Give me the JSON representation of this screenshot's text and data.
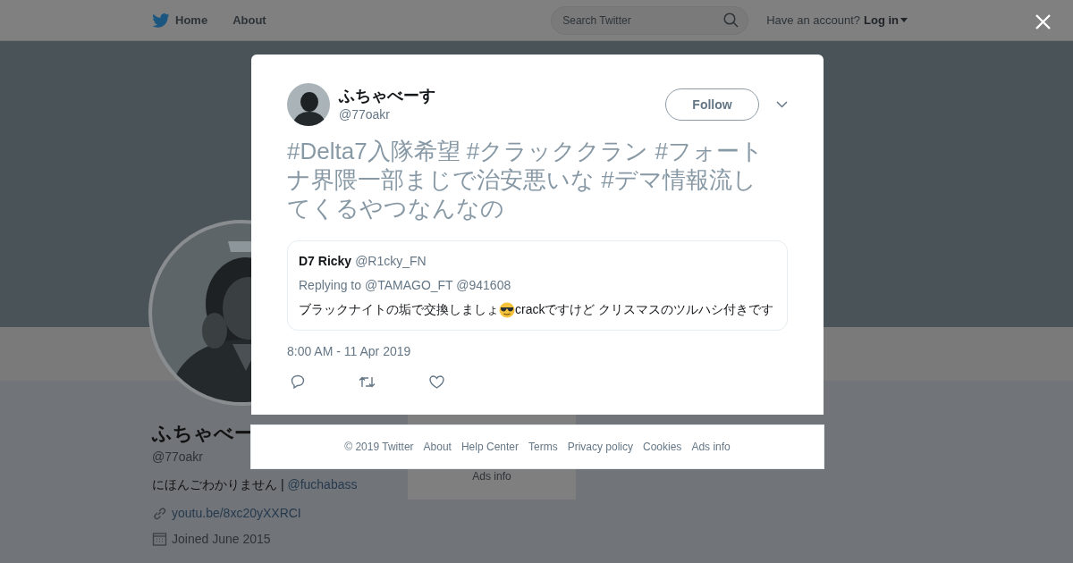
{
  "nav": {
    "items": [
      {
        "label": "Home",
        "kind": "logo"
      },
      {
        "label": "About",
        "kind": "plain"
      }
    ],
    "search": {
      "placeholder": "Search Twitter"
    },
    "account_prompt": "Have an account?",
    "login": "Log in"
  },
  "profile": {
    "name": "ふちゃべー",
    "handle": "@77oakr",
    "bio": "にほんごわかりません | ",
    "bio_link": "@fuchabass",
    "link": "youtu.be/8xc20yXXRCI",
    "joined": "Joined June 2015"
  },
  "sidebar": {
    "ads_info": "Ads info"
  },
  "tweet": {
    "name": "ふちゃべーす",
    "handle": "@77oakr",
    "follow": "Follow",
    "text": "#Delta7入隊希望 #クラッククラン #フォートナ界隈一部まじで治安悪いな #デマ情報流してくるやつなんなの",
    "quote": {
      "name": "D7 Ricky",
      "handle": "@R1cky_FN",
      "replying": "Replying to @TAMAGO_FT @941608",
      "text_before": "ブラックナイトの垢で交換しましょ",
      "text_after": "crackですけど クリスマスのツルハシ付きです"
    },
    "time": "8:00 AM - 11 Apr 2019"
  },
  "footer": {
    "links": [
      "© 2019 Twitter",
      "About",
      "Help Center",
      "Terms",
      "Privacy policy",
      "Cookies",
      "Ads info"
    ]
  }
}
